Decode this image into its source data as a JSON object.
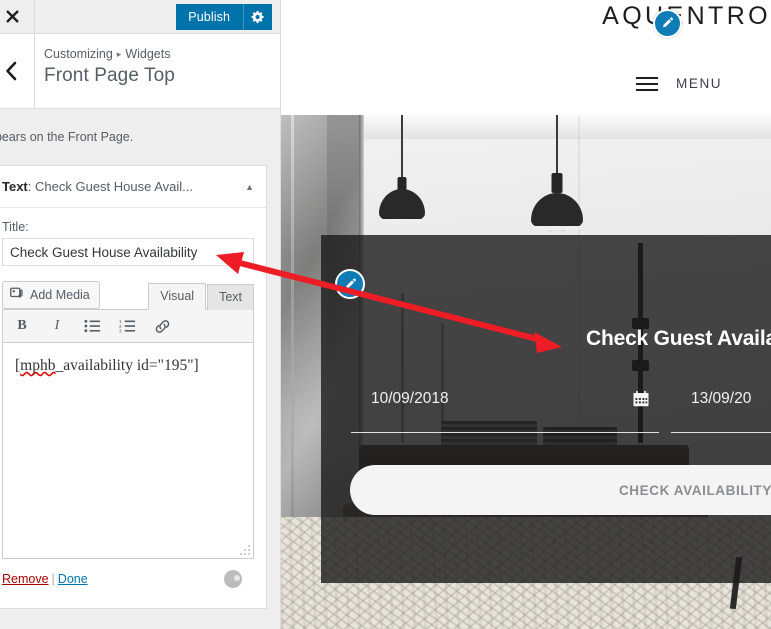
{
  "customizer": {
    "topbar": {
      "close_icon": "close-icon",
      "publish_label": "Publish",
      "gear_icon": "gear-icon"
    },
    "header": {
      "back_icon": "chevron-left-icon",
      "breadcrumb_parent": "Customizing",
      "breadcrumb_separator": "▸",
      "breadcrumb_current": "Widgets",
      "panel_title": "Front Page Top"
    },
    "description": "ppears on the Front Page.",
    "widget": {
      "type_label": "Text",
      "type_separator": ":",
      "name_truncated": "Check Guest House Avail...",
      "collapse_icon": "chevron-up-icon",
      "title_field_label": "Title:",
      "title_value": "Check Guest House Availability",
      "add_media_label": "Add Media",
      "add_media_icon": "media-icon",
      "tabs": [
        {
          "label": "Visual",
          "active": true
        },
        {
          "label": "Text",
          "active": false
        }
      ],
      "toolbar_buttons": [
        {
          "name": "bold-icon",
          "glyph": "B"
        },
        {
          "name": "italic-icon",
          "glyph": "I"
        },
        {
          "name": "bulleted-list-icon",
          "glyph": ""
        },
        {
          "name": "numbered-list-icon",
          "glyph": ""
        },
        {
          "name": "link-icon",
          "glyph": ""
        }
      ],
      "content_misspelled": "mphb",
      "content_rest": "_availability id=\"195\"",
      "content_open_bracket": "[",
      "content_full": "[mphb_availability id=\"195\"]",
      "footer": {
        "remove_label": "Remove",
        "separator": "|",
        "done_label": "Done",
        "spinner_name": "spinner"
      }
    }
  },
  "preview": {
    "logo_text": "AQUENTRO",
    "logo_edit_icon": "edit-pencil-icon",
    "menu_label": "MENU",
    "menu_icon": "hamburger-icon",
    "hero_edit_icon": "edit-pencil-icon",
    "booking": {
      "title": "Check Guest Availability",
      "check_in": "10/09/2018",
      "check_out": "13/09/20",
      "calendar_icon": "calendar-icon",
      "submit_label": "CHECK AVAILABILITY"
    }
  },
  "annotation": {
    "arrow_color": "#ee1c25",
    "arrow_name": "double-headed-arrow"
  },
  "colors": {
    "wp_blue": "#0073aa",
    "edit_blue": "#0f7cb5",
    "remove_red": "#a00000",
    "link_blue": "#0073aa",
    "annotation_red": "#ee1c25",
    "overlay_dark": "rgba(26,26,26,0.80)"
  }
}
